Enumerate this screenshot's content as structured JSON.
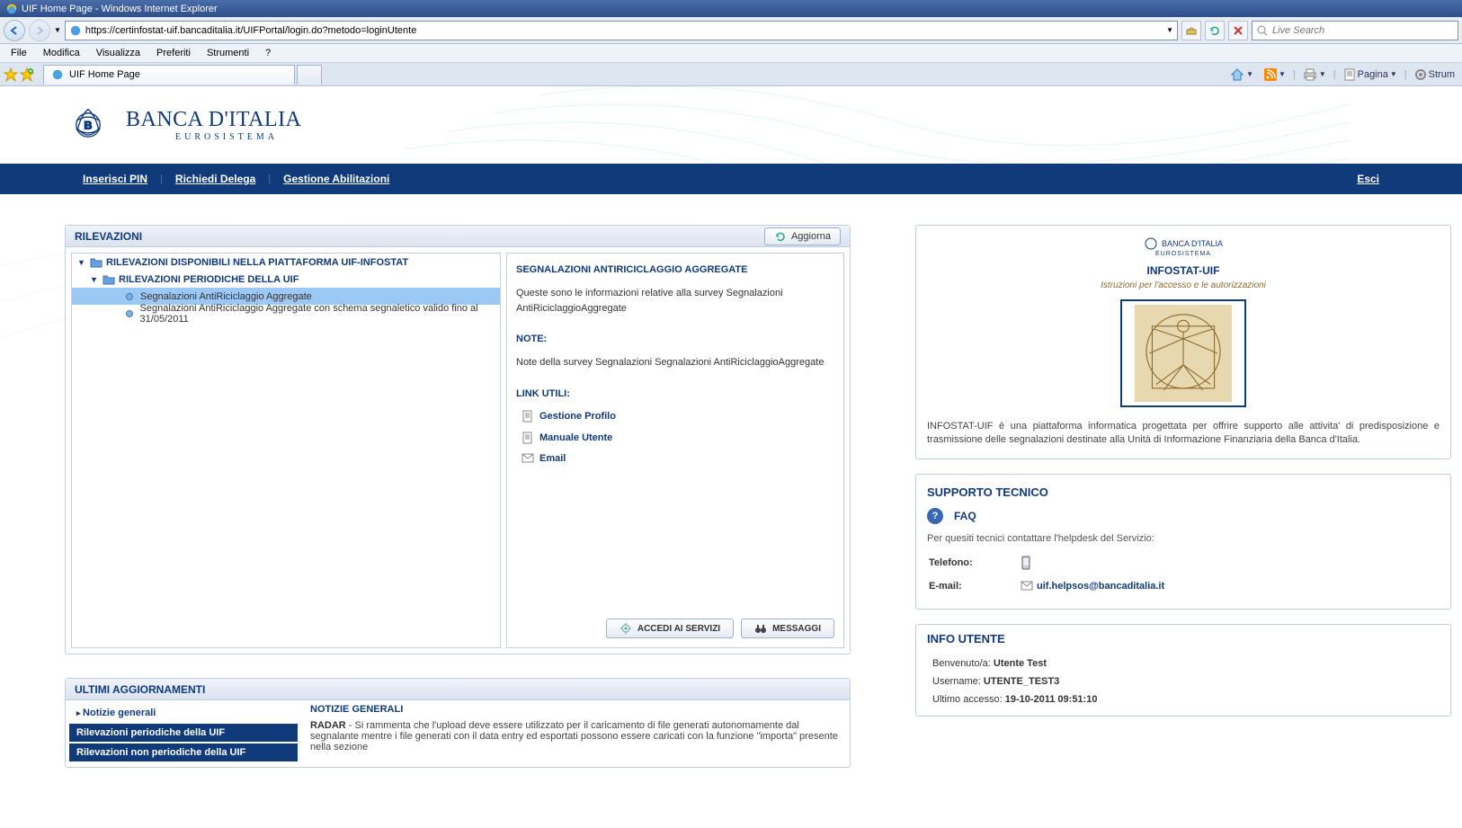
{
  "browser": {
    "title": "UIF Home Page - Windows Internet Explorer",
    "url": "https://certinfostat-uif.bancaditalia.it/UIFPortal/login.do?metodo=loginUtente",
    "search_placeholder": "Live Search",
    "menu": {
      "file": "File",
      "modifica": "Modifica",
      "visualizza": "Visualizza",
      "preferiti": "Preferiti",
      "strumenti": "Strumenti",
      "help": "?"
    },
    "tab_title": "UIF Home Page",
    "cmd": {
      "pagina": "Pagina",
      "strum": "Strum"
    }
  },
  "logo": {
    "main": "BANCA D'ITALIA",
    "sub": "EUROSISTEMA"
  },
  "nav": {
    "pin": "Inserisci PIN",
    "delega": "Richiedi Delega",
    "abil": "Gestione Abilitazioni",
    "esci": "Esci"
  },
  "rilevazioni": {
    "title": "RILEVAZIONI",
    "refresh": "Aggiorna",
    "tree": {
      "root": "RILEVAZIONI DISPONIBILI NELLA PIATTAFORMA UIF-INFOSTAT",
      "l1": "RILEVAZIONI PERIODICHE DELLA UIF",
      "item1": "Segnalazioni AntiRiciclaggio Aggregate",
      "item2": "Segnalazioni AntiRiciclaggio Aggregate con schema segnaletico valido fino al 31/05/2011"
    },
    "detail": {
      "title": "SEGNALAZIONI ANTIRICICLAGGIO AGGREGATE",
      "desc": "Queste sono le informazioni relative alla survey Segnalazioni AntiRiciclaggioAggregate",
      "note_label": "NOTE:",
      "note_text": "Note della survey Segnalazioni Segnalazioni AntiRiciclaggioAggregate",
      "links_label": "LINK UTILI:",
      "link1": "Gestione Profilo",
      "link2": "Manuale Utente",
      "link3": "Email",
      "btn_accedi": "ACCEDI AI SERVIZI",
      "btn_msg": "MESSAGGI"
    }
  },
  "updates": {
    "title": "ULTIMI AGGIORNAMENTI",
    "nav": {
      "n1": "Notizie generali",
      "n2": "Rilevazioni periodiche della UIF",
      "n3": "Rilevazioni non periodiche della UIF"
    },
    "general_title": "NOTIZIE GENERALI",
    "radar_label": "RADAR",
    "radar_text": " - Si rammenta che l'upload deve essere utilizzato per il caricamento di file generati autonomamente dal segnalante mentre i file generati con il data entry ed esportati possono essere caricati con la funzione \"importa\" presente nella sezione"
  },
  "brochure": {
    "brand": "BANCA D'ITALIA",
    "brand_sub": "EUROSISTEMA",
    "title": "INFOSTAT-UIF",
    "subtitle": "Istruzioni per l'accesso e le autorizzazioni",
    "desc": "INFOSTAT-UIF è una piattaforma informatica progettata per offrire supporto alle attivita' di predisposizione e trasmissione delle segnalazioni destinate alla Unità di Informazione Finanziaria della Banca d'Italia."
  },
  "support": {
    "title": "SUPPORTO TECNICO",
    "faq": "FAQ",
    "line": "Per quesiti tecnici contattare l'helpdesk del Servizio:",
    "tel_label": "Telefono:",
    "email_label": "E-mail:",
    "email": "uif.helpsos@bancaditalia.it"
  },
  "userinfo": {
    "title": "INFO UTENTE",
    "welcome_label": "Benvenuto/a:",
    "welcome_value": "Utente  Test",
    "user_label": "Username:",
    "user_value": "UTENTE_TEST3",
    "last_label": "Ultimo accesso:",
    "last_value": "19-10-2011 09:51:10"
  }
}
